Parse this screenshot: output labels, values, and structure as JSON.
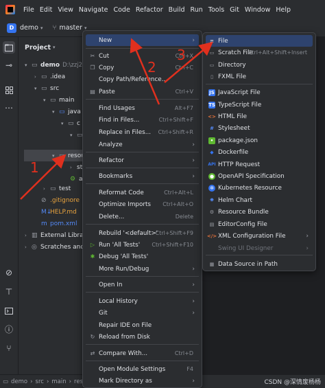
{
  "menubar": {
    "items": [
      "File",
      "Edit",
      "View",
      "Navigate",
      "Code",
      "Refactor",
      "Build",
      "Run",
      "Tools",
      "Git",
      "Window",
      "Help"
    ]
  },
  "toolbar": {
    "project_badge": "D",
    "project_name": "demo",
    "branch": "master"
  },
  "panel": {
    "title": "Project",
    "tree": [
      {
        "label": "demo",
        "path": "D:\\zzj240",
        "icon": "folder-icon",
        "arrow": "▾"
      },
      {
        "label": ".idea",
        "icon": "folder-icon",
        "arrow": "›"
      },
      {
        "label": "src",
        "icon": "folder-icon",
        "arrow": "▾"
      },
      {
        "label": "main",
        "icon": "folder-icon",
        "arrow": "▾"
      },
      {
        "label": "java",
        "icon": "folder-icon",
        "arrow": "▾"
      },
      {
        "label": "c",
        "icon": "package-icon",
        "arrow": "▾"
      },
      {
        "label": "",
        "icon": "class-icon",
        "arrow": "▾"
      },
      {
        "label": "resou",
        "icon": "resources-folder-icon",
        "arrow": "▾"
      },
      {
        "label": "st",
        "icon": "folder-icon",
        "arrow": "›"
      },
      {
        "label": "a",
        "icon": "properties-icon",
        "arrow": ""
      },
      {
        "label": "test",
        "icon": "folder-icon",
        "arrow": "›"
      },
      {
        "label": ".gitignore",
        "icon": "gitignore-icon",
        "arrow": ""
      },
      {
        "label": "HELP.md",
        "icon": "markdown-icon",
        "arrow": ""
      },
      {
        "label": "pom.xml",
        "icon": "maven-icon",
        "arrow": ""
      },
      {
        "label": "External Libraries",
        "icon": "library-icon",
        "arrow": "›"
      },
      {
        "label": "Scratches and Co",
        "icon": "scratches-icon",
        "arrow": "›"
      }
    ]
  },
  "context_menu": {
    "items": [
      {
        "label": "New",
        "shortcut": "",
        "submenu": true,
        "icon": ""
      },
      {
        "label": "Cut",
        "shortcut": "Ctrl+X",
        "icon": "cut-icon"
      },
      {
        "label": "Copy",
        "shortcut": "Ctrl+C",
        "icon": "copy-icon"
      },
      {
        "label": "Copy Path/Reference...",
        "shortcut": "",
        "icon": ""
      },
      {
        "label": "Paste",
        "shortcut": "Ctrl+V",
        "icon": "paste-icon"
      },
      {
        "label": "Find Usages",
        "shortcut": "Alt+F7",
        "icon": ""
      },
      {
        "label": "Find in Files...",
        "shortcut": "Ctrl+Shift+F",
        "icon": ""
      },
      {
        "label": "Replace in Files...",
        "shortcut": "Ctrl+Shift+R",
        "icon": ""
      },
      {
        "label": "Analyze",
        "shortcut": "",
        "submenu": true,
        "icon": ""
      },
      {
        "label": "Refactor",
        "shortcut": "",
        "submenu": true,
        "icon": ""
      },
      {
        "label": "Bookmarks",
        "shortcut": "",
        "submenu": true,
        "icon": ""
      },
      {
        "label": "Reformat Code",
        "shortcut": "Ctrl+Alt+L",
        "icon": ""
      },
      {
        "label": "Optimize Imports",
        "shortcut": "Ctrl+Alt+O",
        "icon": ""
      },
      {
        "label": "Delete...",
        "shortcut": "Delete",
        "icon": ""
      },
      {
        "label": "Rebuild '<default>'",
        "shortcut": "Ctrl+Shift+F9",
        "icon": ""
      },
      {
        "label": "Run 'All Tests'",
        "shortcut": "Ctrl+Shift+F10",
        "icon": "run-icon"
      },
      {
        "label": "Debug 'All Tests'",
        "shortcut": "",
        "icon": "debug-icon"
      },
      {
        "label": "More Run/Debug",
        "shortcut": "",
        "submenu": true,
        "icon": ""
      },
      {
        "label": "Open In",
        "shortcut": "",
        "submenu": true,
        "icon": ""
      },
      {
        "label": "Local History",
        "shortcut": "",
        "submenu": true,
        "icon": ""
      },
      {
        "label": "Git",
        "shortcut": "",
        "submenu": true,
        "icon": ""
      },
      {
        "label": "Repair IDE on File",
        "shortcut": "",
        "icon": ""
      },
      {
        "label": "Reload from Disk",
        "shortcut": "",
        "icon": "reload-icon"
      },
      {
        "label": "Compare With...",
        "shortcut": "Ctrl+D",
        "icon": "compare-icon"
      },
      {
        "label": "Open Module Settings",
        "shortcut": "F4",
        "icon": ""
      },
      {
        "label": "Mark Directory as",
        "shortcut": "",
        "submenu": true,
        "icon": ""
      }
    ]
  },
  "new_submenu": {
    "items": [
      {
        "label": "File",
        "shortcut": "",
        "icon": "file-icon",
        "color": "#9da0a8"
      },
      {
        "label": "Scratch File",
        "shortcut": "Ctrl+Alt+Shift+Insert",
        "icon": "scratch-file-icon",
        "color": "#9da0a8"
      },
      {
        "label": "Directory",
        "shortcut": "",
        "icon": "directory-icon",
        "color": "#9da0a8"
      },
      {
        "label": "FXML File",
        "shortcut": "",
        "icon": "fxml-file-icon",
        "color": "#9da0a8"
      },
      {
        "label": "JavaScript File",
        "shortcut": "",
        "icon": "javascript-file-icon",
        "color": "#3574f0"
      },
      {
        "label": "TypeScript File",
        "shortcut": "",
        "icon": "typescript-file-icon",
        "color": "#3574f0"
      },
      {
        "label": "HTML File",
        "shortcut": "",
        "icon": "html-file-icon",
        "color": "#e8743b"
      },
      {
        "label": "Stylesheet",
        "shortcut": "",
        "icon": "stylesheet-icon",
        "color": "#548af7"
      },
      {
        "label": "package.json",
        "shortcut": "",
        "icon": "package-json-icon",
        "color": "#5fb832"
      },
      {
        "label": "Dockerfile",
        "shortcut": "",
        "icon": "dockerfile-icon",
        "color": "#3574f0"
      },
      {
        "label": "HTTP Request",
        "shortcut": "",
        "icon": "http-request-icon",
        "color": "#3574f0"
      },
      {
        "label": "OpenAPI Specification",
        "shortcut": "",
        "icon": "openapi-icon",
        "color": "#5fb832"
      },
      {
        "label": "Kubernetes Resource",
        "shortcut": "",
        "icon": "kubernetes-icon",
        "color": "#3574f0"
      },
      {
        "label": "Helm Chart",
        "shortcut": "",
        "icon": "helm-chart-icon",
        "color": "#548af7"
      },
      {
        "label": "Resource Bundle",
        "shortcut": "",
        "icon": "resource-bundle-icon",
        "color": "#9da0a8"
      },
      {
        "label": "EditorConfig File",
        "shortcut": "",
        "icon": "editorconfig-icon",
        "color": "#9da0a8"
      },
      {
        "label": "XML Configuration File",
        "shortcut": "",
        "icon": "xml-config-icon",
        "color": "#e8743b",
        "submenu": true
      },
      {
        "label": "Swing UI Designer",
        "shortcut": "",
        "icon": "swing-icon",
        "color": "#6f737a",
        "submenu": true,
        "disabled": true
      },
      {
        "label": "Data Source in Path",
        "shortcut": "",
        "icon": "data-source-icon",
        "color": "#9da0a8"
      }
    ]
  },
  "statusbar": {
    "crumbs": [
      "demo",
      "src",
      "main",
      "resources"
    ],
    "watermark": "CSDN @深情废杨杨"
  },
  "annotations": {
    "numbers": [
      "1",
      "2",
      "3"
    ],
    "color": "#e0301e"
  }
}
